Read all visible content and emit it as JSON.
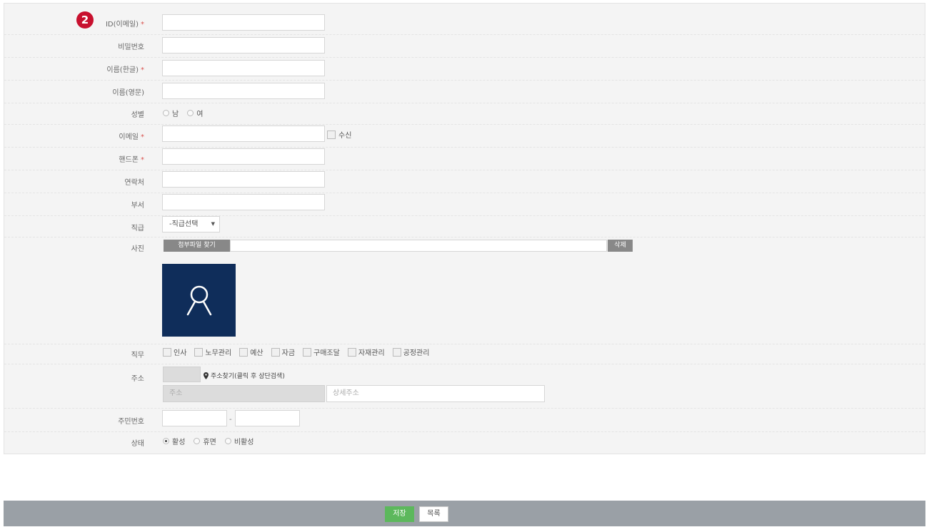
{
  "step_badge": "2",
  "fields": {
    "id": {
      "label": "ID(이메일)",
      "required": "*"
    },
    "password": {
      "label": "비밀번호"
    },
    "name_kr": {
      "label": "이름(한글)",
      "required": "*"
    },
    "name_en": {
      "label": "이름(영문)"
    },
    "gender": {
      "label": "성별",
      "options": [
        "남",
        "여"
      ]
    },
    "email": {
      "label": "이메일",
      "required": "*",
      "receive_label": "수신"
    },
    "mobile": {
      "label": "핸드폰",
      "required": "*"
    },
    "contact": {
      "label": "연락처"
    },
    "department": {
      "label": "부서"
    },
    "position": {
      "label": "직급",
      "selected": "-직급선택"
    },
    "photo": {
      "label": "사진",
      "attach_button": "첨부파일 찾기",
      "delete_button": "삭제"
    },
    "duty": {
      "label": "직무",
      "options": [
        "인사",
        "노무관리",
        "예산",
        "자금",
        "구매조달",
        "자재관리",
        "공정관리"
      ]
    },
    "address": {
      "label": "주소",
      "find_link": "주소찾기(클릭 후 상단검색)",
      "addr_placeholder": "주소",
      "detail_placeholder": "상세주소"
    },
    "resident_no": {
      "label": "주민번호",
      "separator": "-"
    },
    "status": {
      "label": "상태",
      "options": [
        "활성",
        "휴면",
        "비활성"
      ],
      "selected": "활성"
    }
  },
  "footer": {
    "save": "저장",
    "list": "목록"
  },
  "colors": {
    "badge": "#c8102e",
    "photo_bg": "#0f2d5a",
    "save_btn": "#5cb85c",
    "footer_bar": "#9aa0a6"
  }
}
